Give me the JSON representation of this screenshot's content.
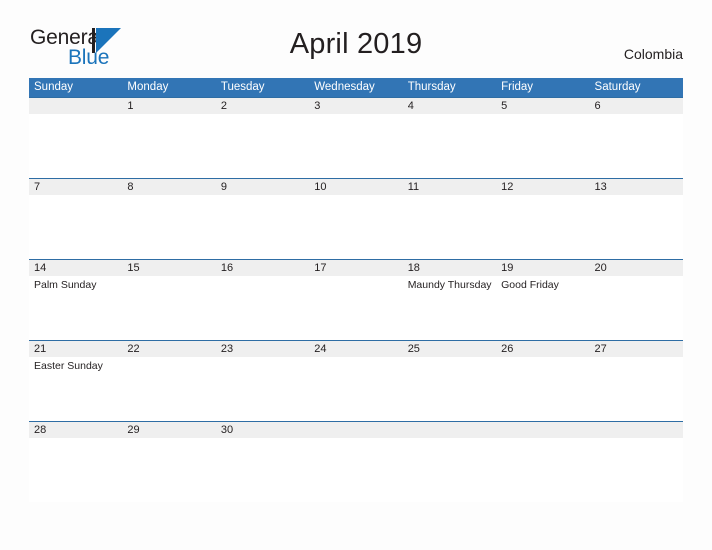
{
  "brand": {
    "name_part1": "General",
    "name_part2": "Blue",
    "logo_icon": "triangle-flag-icon"
  },
  "header": {
    "title": "April 2019",
    "country": "Colombia"
  },
  "colors": {
    "header_blue": "#3275b5",
    "row_divider_blue": "#2e6da4",
    "band_gray": "#efefef",
    "brand_blue": "#1b74bb",
    "text_dark": "#231f20",
    "page_background": "#fdfdfd"
  },
  "calendar": {
    "month": "April",
    "year": "2019",
    "weekday_headers": [
      "Sunday",
      "Monday",
      "Tuesday",
      "Wednesday",
      "Thursday",
      "Friday",
      "Saturday"
    ],
    "weeks": [
      [
        {
          "day": "",
          "event": ""
        },
        {
          "day": "1",
          "event": ""
        },
        {
          "day": "2",
          "event": ""
        },
        {
          "day": "3",
          "event": ""
        },
        {
          "day": "4",
          "event": ""
        },
        {
          "day": "5",
          "event": ""
        },
        {
          "day": "6",
          "event": ""
        }
      ],
      [
        {
          "day": "7",
          "event": ""
        },
        {
          "day": "8",
          "event": ""
        },
        {
          "day": "9",
          "event": ""
        },
        {
          "day": "10",
          "event": ""
        },
        {
          "day": "11",
          "event": ""
        },
        {
          "day": "12",
          "event": ""
        },
        {
          "day": "13",
          "event": ""
        }
      ],
      [
        {
          "day": "14",
          "event": "Palm Sunday"
        },
        {
          "day": "15",
          "event": ""
        },
        {
          "day": "16",
          "event": ""
        },
        {
          "day": "17",
          "event": ""
        },
        {
          "day": "18",
          "event": "Maundy Thursday"
        },
        {
          "day": "19",
          "event": "Good Friday"
        },
        {
          "day": "20",
          "event": ""
        }
      ],
      [
        {
          "day": "21",
          "event": "Easter Sunday"
        },
        {
          "day": "22",
          "event": ""
        },
        {
          "day": "23",
          "event": ""
        },
        {
          "day": "24",
          "event": ""
        },
        {
          "day": "25",
          "event": ""
        },
        {
          "day": "26",
          "event": ""
        },
        {
          "day": "27",
          "event": ""
        }
      ],
      [
        {
          "day": "28",
          "event": ""
        },
        {
          "day": "29",
          "event": ""
        },
        {
          "day": "30",
          "event": ""
        },
        {
          "day": "",
          "event": ""
        },
        {
          "day": "",
          "event": ""
        },
        {
          "day": "",
          "event": ""
        },
        {
          "day": "",
          "event": ""
        }
      ]
    ]
  }
}
